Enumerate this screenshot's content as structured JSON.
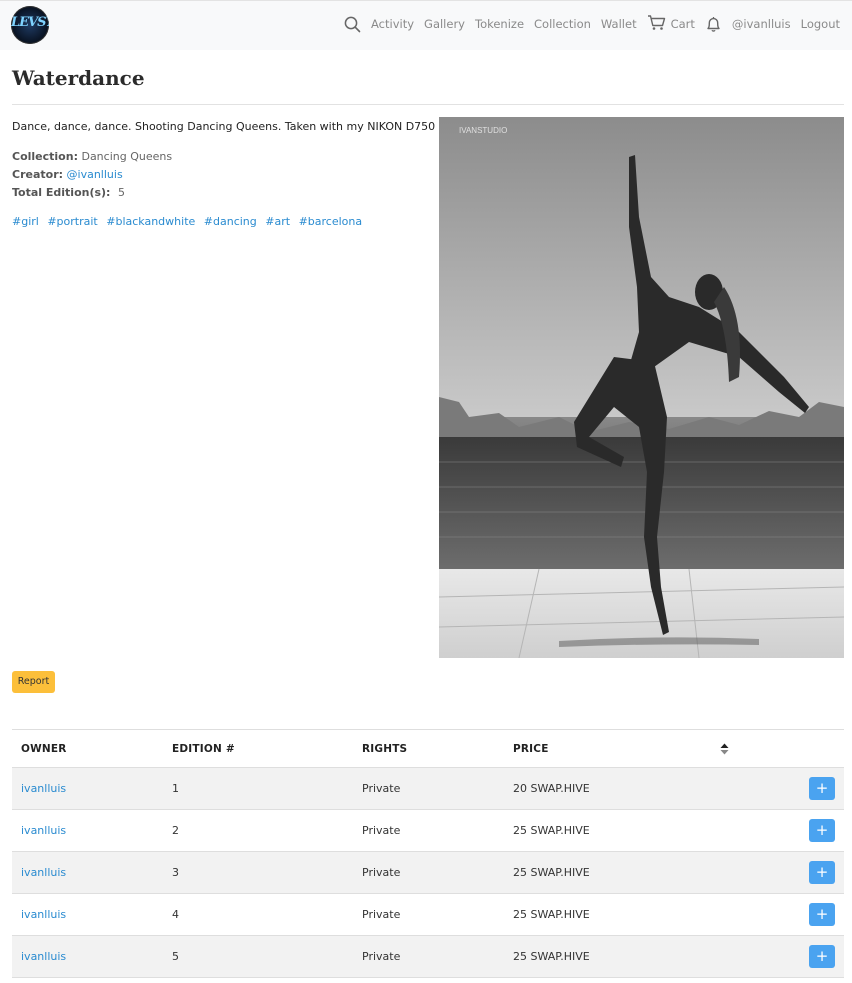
{
  "nav": {
    "logo_text": "LEVSY",
    "links": [
      "Activity",
      "Gallery",
      "Tokenize",
      "Collection",
      "Wallet"
    ],
    "cart_label": "Cart",
    "user": "@ivanlluis",
    "logout": "Logout"
  },
  "page": {
    "title": "Waterdance",
    "description": "Dance, dance, dance. Shooting Dancing Queens. Taken with my NIKON D750",
    "collection_label": "Collection:",
    "collection_value": "Dancing Queens",
    "creator_label": "Creator:",
    "creator_value": "@ivanlluis",
    "editions_label": "Total Edition(s):",
    "editions_value": "5",
    "tags": [
      "#girl",
      "#portrait",
      "#blackandwhite",
      "#dancing",
      "#art",
      "#barcelona"
    ],
    "photo_watermark": "IVANSTUDIO",
    "report_label": "Report"
  },
  "table": {
    "headers": {
      "owner": "OWNER",
      "edition": "EDITION #",
      "rights": "RIGHTS",
      "price": "PRICE"
    },
    "add_label": "+",
    "rows": [
      {
        "owner": "ivanlluis",
        "edition": "1",
        "rights": "Private",
        "price": "20 SWAP.HIVE"
      },
      {
        "owner": "ivanlluis",
        "edition": "2",
        "rights": "Private",
        "price": "25 SWAP.HIVE"
      },
      {
        "owner": "ivanlluis",
        "edition": "3",
        "rights": "Private",
        "price": "25 SWAP.HIVE"
      },
      {
        "owner": "ivanlluis",
        "edition": "4",
        "rights": "Private",
        "price": "25 SWAP.HIVE"
      },
      {
        "owner": "ivanlluis",
        "edition": "5",
        "rights": "Private",
        "price": "25 SWAP.HIVE"
      }
    ]
  },
  "colors": {
    "link": "#2a8bd0",
    "report_button": "#fcbf3a",
    "add_button": "#4aa3f0",
    "navbar_bg": "#f8f9fa"
  },
  "icons": [
    "search-icon",
    "cart-icon",
    "bell-icon",
    "sort-icon",
    "plus-icon"
  ]
}
